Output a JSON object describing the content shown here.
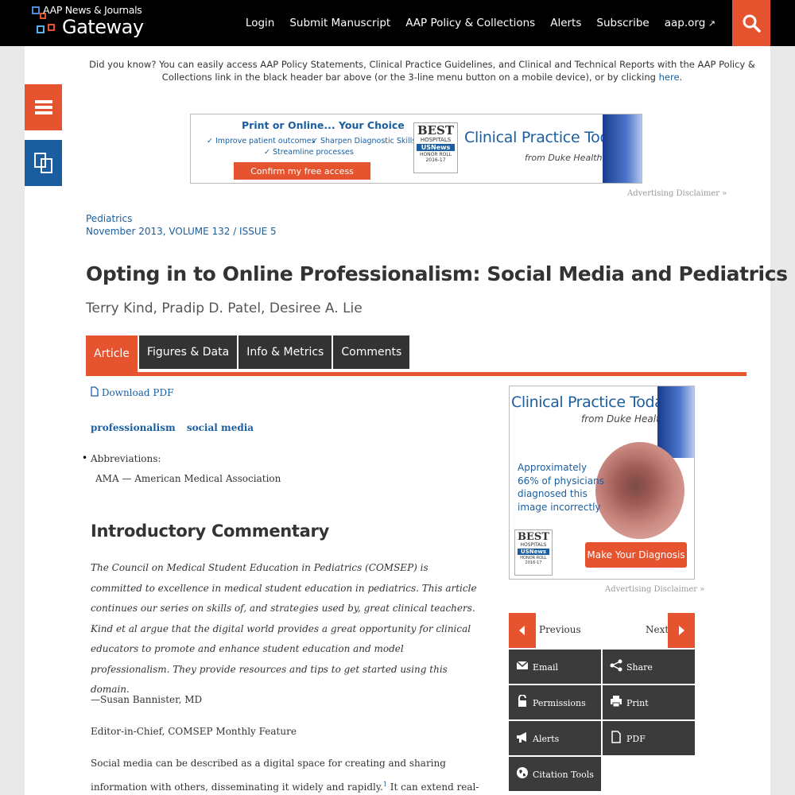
{
  "header": {
    "logo_small": "AAP News & Journals",
    "logo_big": "Gateway",
    "nav": [
      "Login",
      "Submit Manuscript",
      "AAP Policy & Collections",
      "Alerts",
      "Subscribe",
      "aap.org"
    ],
    "nav_ext_icon": "external-link-icon",
    "search_icon": "search-icon"
  },
  "notice": {
    "text": "Did you know? You can easily access AAP Policy Statements, Clinical Practice Guidelines, and Clinical and Technical Reports with the AAP Policy & Collections link in the black header bar above (or the 3-line menu button on a mobile device), or by clicking",
    "link": "here",
    "end": "."
  },
  "side": {
    "menu_icon": "hamburger-menu-icon",
    "tools_icon": "copy-pages-icon"
  },
  "banner_ad": {
    "title": "Print or Online... Your Choice",
    "bullets": [
      "✓ Improve patient outcomes",
      "✓ Sharpen Diagnostic Skills",
      "✓ Streamline processes"
    ],
    "cta": "Confirm my free access",
    "badge_best": "BEST",
    "badge_hosp": "HOSPITALS",
    "badge_usn": "USNews",
    "badge_honor": "HONOR ROLL",
    "badge_year": "2016-17",
    "brand": "Clinical Practice Today",
    "brand_sub": "from Duke Health",
    "disclaimer": "Advertising Disclaimer »"
  },
  "journal": {
    "name": "Pediatrics",
    "issue": "November 2013, VOLUME 132 / ISSUE 5"
  },
  "article": {
    "title": "Opting in to Online Professionalism: Social Media and Pediatrics",
    "authors": "Terry Kind, Pradip D. Patel, Desiree A. Lie",
    "tabs": [
      "Article",
      "Figures & Data",
      "Info & Metrics",
      "Comments"
    ],
    "download_pdf": "Download PDF",
    "keywords": [
      "professionalism",
      "social media"
    ],
    "abbr_title": "Abbreviations:",
    "abbr_item": "AMA — American Medical Association",
    "section_heading": "Introductory Commentary",
    "intro": "The Council on Medical Student Education in Pediatrics (COMSEP) is committed to excellence in medical student education in pediatrics. This article continues our series on skills of, and strategies used by, great clinical teachers. Kind et al argue that the digital world provides a great opportunity for clinical educators to promote and enhance student education and model professionalism. They provide resources and tips to get started using this domain.",
    "signature": "—Susan Bannister, MD",
    "signature_role": "Editor-in-Chief, COMSEP Monthly Feature",
    "para_start": "Social media can be described as a digital space for creating and sharing information with others, disseminating it widely and rapidly.",
    "para_ref": "1",
    "para_rest": " It can extend real-life learning and"
  },
  "side_ad": {
    "brand": "Clinical Practice Today",
    "brand_sub": "from Duke Health",
    "text": "Approximately 66% of physicians diagnosed this image incorrectly",
    "cta": "Make Your Diagnosis",
    "badge_best": "BEST",
    "badge_hosp": "HOSPITALS",
    "badge_usn": "USNews",
    "badge_honor": "HONOR ROLL",
    "badge_year": "2016-17",
    "disclaimer": "Advertising Disclaimer »"
  },
  "tools": {
    "previous": "Previous",
    "next": "Next",
    "items": [
      {
        "label": "Email",
        "icon": "email-icon"
      },
      {
        "label": "Share",
        "icon": "share-icon"
      },
      {
        "label": "Permissions",
        "icon": "lock-icon"
      },
      {
        "label": "Print",
        "icon": "print-icon"
      },
      {
        "label": "Alerts",
        "icon": "megaphone-icon"
      },
      {
        "label": "PDF",
        "icon": "pdf-icon"
      },
      {
        "label": "Citation Tools",
        "icon": "globe-icon"
      }
    ]
  },
  "colors": {
    "accent": "#e5532f",
    "link": "#1a5e9f",
    "dark": "#333333",
    "header": "#000000"
  }
}
